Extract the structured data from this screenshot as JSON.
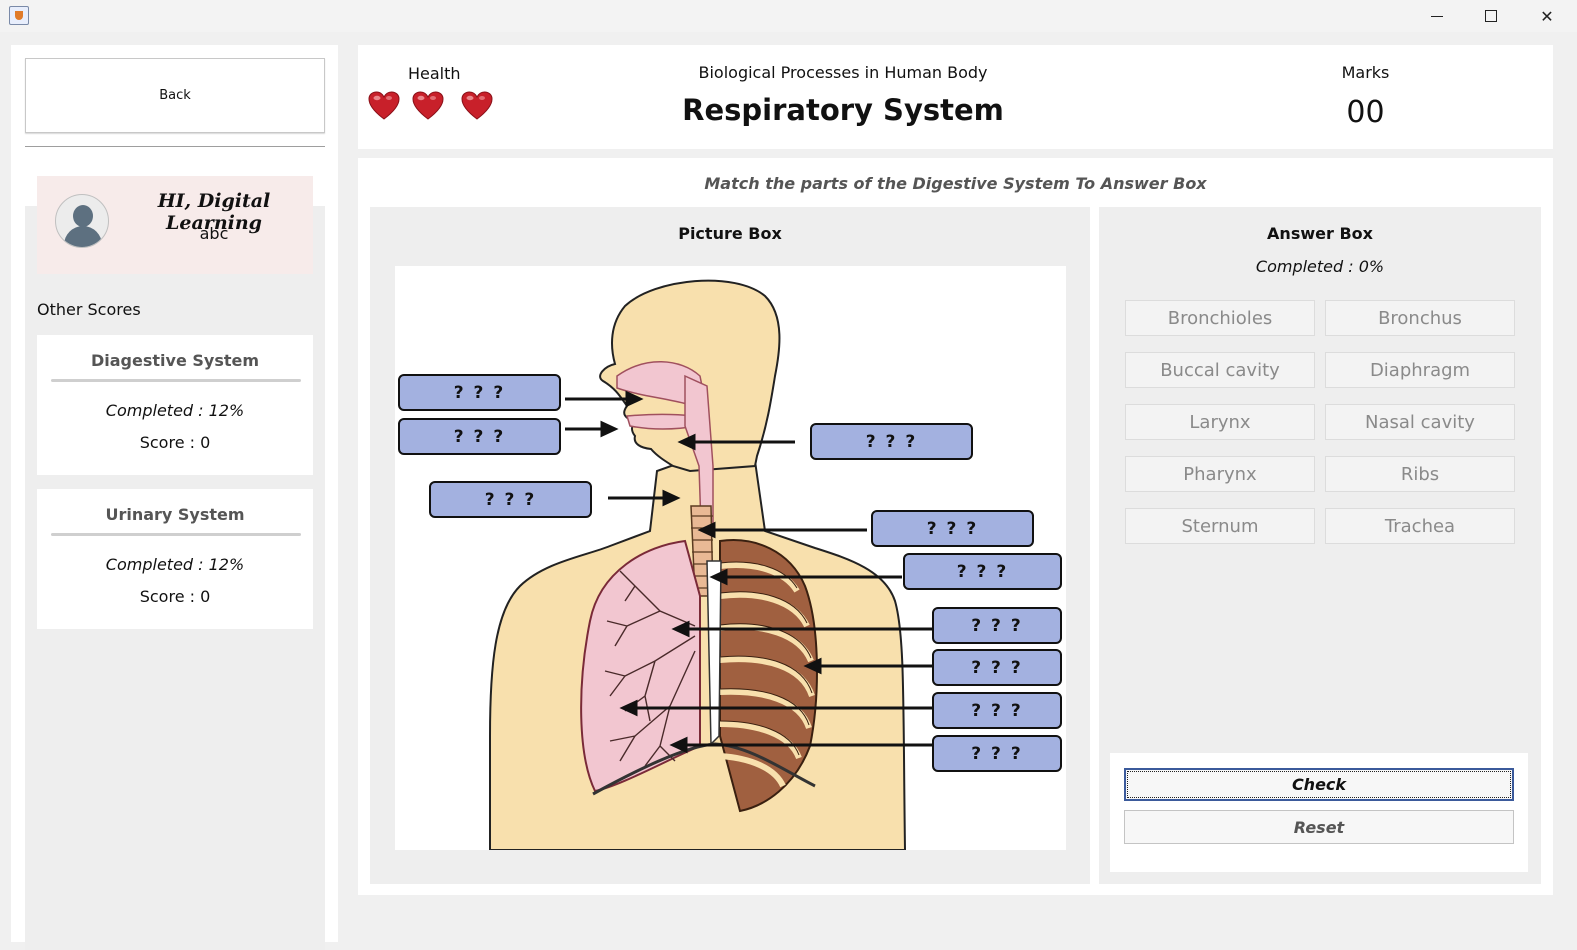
{
  "window": {
    "minimize_glyph": "",
    "maximize_glyph": "",
    "close_glyph": "✕"
  },
  "sidebar": {
    "back_label": "Back",
    "greeting": "HI, Digital Learning",
    "username": "abc",
    "other_scores_label": "Other Scores",
    "scores": [
      {
        "name": "Diagestive System",
        "completed": "Completed : 12%",
        "score": "Score : 0"
      },
      {
        "name": "Urinary System",
        "completed": "Completed : 12%",
        "score": "Score : 0"
      }
    ]
  },
  "header": {
    "health_label": "Health",
    "health_hearts": 3,
    "subject": "Biological Processes in  Human Body",
    "topic": "Respiratory System",
    "marks_label": "Marks",
    "marks_value": "00"
  },
  "main": {
    "instruction": "Match the parts of the Digestive System To Answer Box",
    "picture_box": {
      "title": "Picture Box",
      "slots": [
        "? ? ?",
        "? ? ?",
        "? ? ?",
        "? ? ?",
        "? ? ?",
        "? ? ?",
        "? ? ?",
        "? ? ?",
        "? ? ?",
        "? ? ?"
      ]
    },
    "answer_box": {
      "title": "Answer Box",
      "completed": "Completed : 0%",
      "terms": [
        "Bronchioles",
        "Bronchus",
        "Buccal cavity",
        "Diaphragm",
        "Larynx",
        "Nasal cavity",
        "Pharynx",
        "Ribs",
        "Sternum",
        "Trachea"
      ],
      "check_label": "Check",
      "reset_label": "Reset"
    }
  },
  "colors": {
    "slot_fill": "#a3b1e0",
    "heart": "#c8202a",
    "profile_bg": "#f7ebea",
    "skin": "#f8e0ad",
    "lung": "#f2c6d0"
  }
}
